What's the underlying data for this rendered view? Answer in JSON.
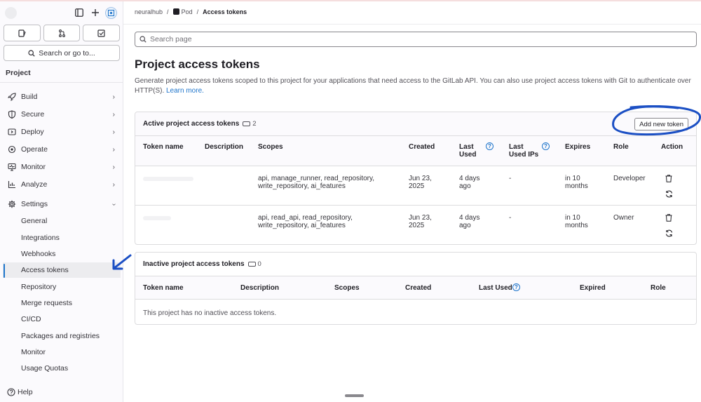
{
  "sidebar": {
    "search_label": "Search or go to...",
    "project_label": "Project",
    "items": [
      {
        "label": "Build",
        "icon": "rocket-icon"
      },
      {
        "label": "Secure",
        "icon": "shield-icon"
      },
      {
        "label": "Deploy",
        "icon": "deploy-icon"
      },
      {
        "label": "Operate",
        "icon": "cloud-gear-icon"
      },
      {
        "label": "Monitor",
        "icon": "monitor-icon"
      },
      {
        "label": "Analyze",
        "icon": "chart-icon"
      },
      {
        "label": "Settings",
        "icon": "gear-icon"
      }
    ],
    "settings_sub": [
      "General",
      "Integrations",
      "Webhooks",
      "Access tokens",
      "Repository",
      "Merge requests",
      "CI/CD",
      "Packages and registries",
      "Monitor",
      "Usage Quotas"
    ],
    "help_label": "Help"
  },
  "breadcrumb": {
    "group": "neuralhub",
    "project": "Pod",
    "current": "Access tokens"
  },
  "search_page_placeholder": "Search page",
  "page": {
    "title": "Project access tokens",
    "description": "Generate project access tokens scoped to this project for your applications that need access to the GitLab API. You can also use project access tokens with Git to authenticate over HTTP(S).",
    "learn_more": "Learn more."
  },
  "active": {
    "title": "Active project access tokens",
    "count": "2",
    "add_button": "Add new token",
    "headers": {
      "token_name": "Token name",
      "description": "Description",
      "scopes": "Scopes",
      "created": "Created",
      "last_used": "Last Used",
      "last_used_ips": "Last Used IPs",
      "expires": "Expires",
      "role": "Role",
      "action": "Action"
    },
    "rows": [
      {
        "scopes_1": "api, manage_runner, read_repository,",
        "scopes_2": "write_repository, ai_features",
        "created_1": "Jun 23,",
        "created_2": "2025",
        "last_used_1": "4 days",
        "last_used_2": "ago",
        "ips": "-",
        "expires_1": "in 10",
        "expires_2": "months",
        "role": "Developer"
      },
      {
        "scopes_1": "api, read_api, read_repository,",
        "scopes_2": "write_repository, ai_features",
        "created_1": "Jun 23,",
        "created_2": "2025",
        "last_used_1": "4 days",
        "last_used_2": "ago",
        "ips": "-",
        "expires_1": "in 10",
        "expires_2": "months",
        "role": "Owner"
      }
    ]
  },
  "inactive": {
    "title": "Inactive project access tokens",
    "count": "0",
    "headers": {
      "token_name": "Token name",
      "description": "Description",
      "scopes": "Scopes",
      "created": "Created",
      "last_used": "Last Used",
      "expired": "Expired",
      "role": "Role"
    },
    "empty": "This project has no inactive access tokens."
  },
  "colors": {
    "link": "#1f75cb",
    "annotation": "#1b4fc4"
  }
}
